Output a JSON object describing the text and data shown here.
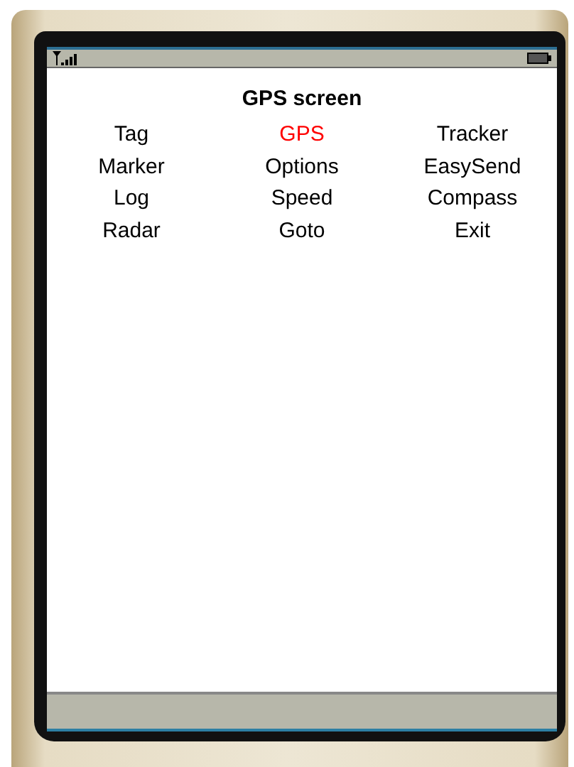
{
  "screen": {
    "title": "GPS screen",
    "menu_items": [
      {
        "label": "Tag",
        "selected": false
      },
      {
        "label": "GPS",
        "selected": true
      },
      {
        "label": "Tracker",
        "selected": false
      },
      {
        "label": "Marker",
        "selected": false
      },
      {
        "label": "Options",
        "selected": false
      },
      {
        "label": "EasySend",
        "selected": false
      },
      {
        "label": "Log",
        "selected": false
      },
      {
        "label": "Speed",
        "selected": false
      },
      {
        "label": "Compass",
        "selected": false
      },
      {
        "label": "Radar",
        "selected": false
      },
      {
        "label": "Goto",
        "selected": false
      },
      {
        "label": "Exit",
        "selected": false
      }
    ]
  }
}
